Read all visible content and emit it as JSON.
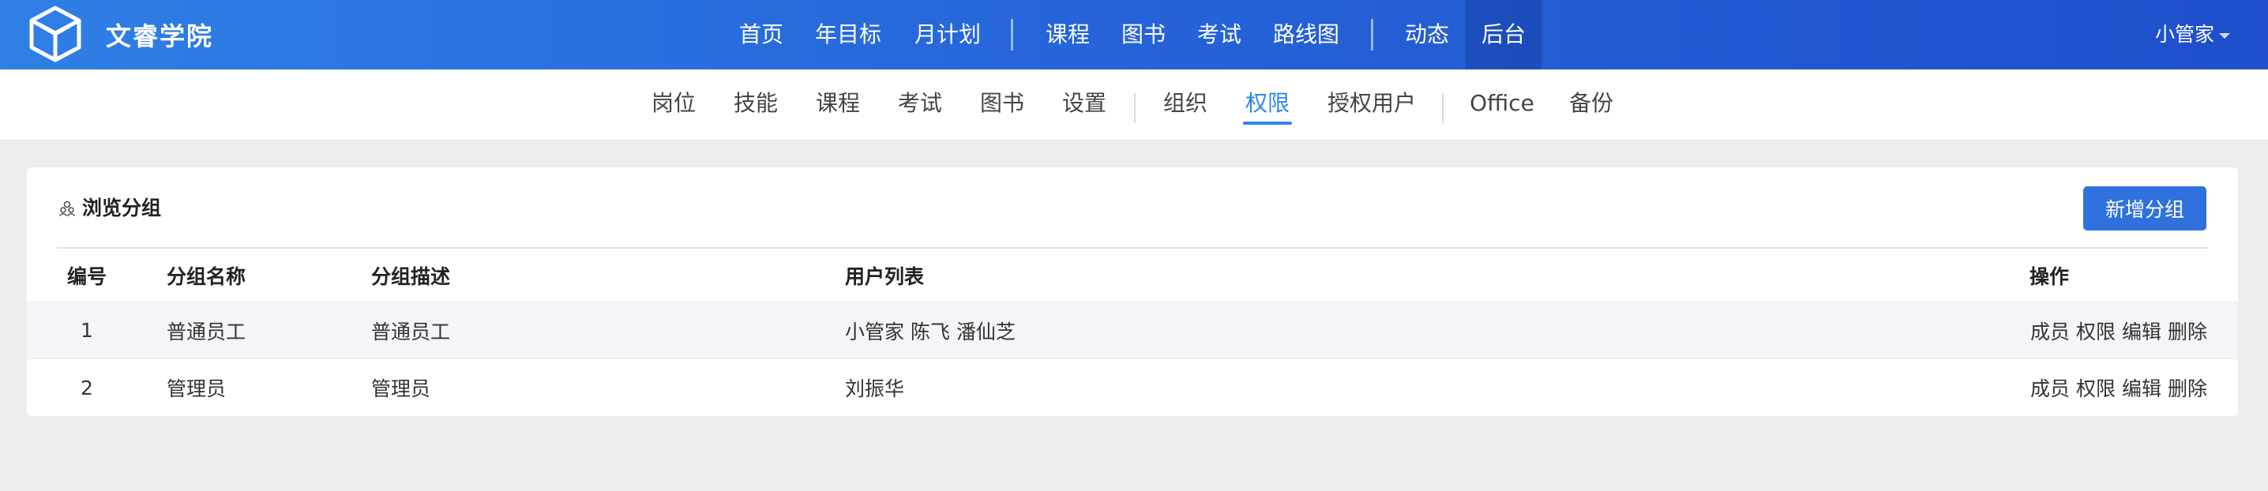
{
  "brand": {
    "name": "文睿学院"
  },
  "topnav": {
    "items": [
      "首页",
      "年目标",
      "月计划",
      "课程",
      "图书",
      "考试",
      "路线图",
      "动态",
      "后台"
    ],
    "active": "后台"
  },
  "user": {
    "name": "小管家"
  },
  "subnav": {
    "items": [
      "岗位",
      "技能",
      "课程",
      "考试",
      "图书",
      "设置",
      "组织",
      "权限",
      "授权用户",
      "Office",
      "备份"
    ],
    "active": "权限"
  },
  "panel": {
    "title": "浏览分组",
    "add_button": "新增分组",
    "columns": {
      "id": "编号",
      "name": "分组名称",
      "desc": "分组描述",
      "users": "用户列表",
      "ops": "操作"
    },
    "rows": [
      {
        "id": "1",
        "name": "普通员工",
        "desc": "普通员工",
        "users": [
          "小管家",
          "陈飞",
          "潘仙芝"
        ]
      },
      {
        "id": "2",
        "name": "管理员",
        "desc": "管理员",
        "users": [
          "刘振华"
        ]
      }
    ],
    "row_actions": [
      "成员",
      "权限",
      "编辑",
      "删除"
    ]
  },
  "colors": {
    "topbar": "#2563d8",
    "accent": "#2f86e8",
    "button": "#2f72dd",
    "background": "#ededed"
  }
}
